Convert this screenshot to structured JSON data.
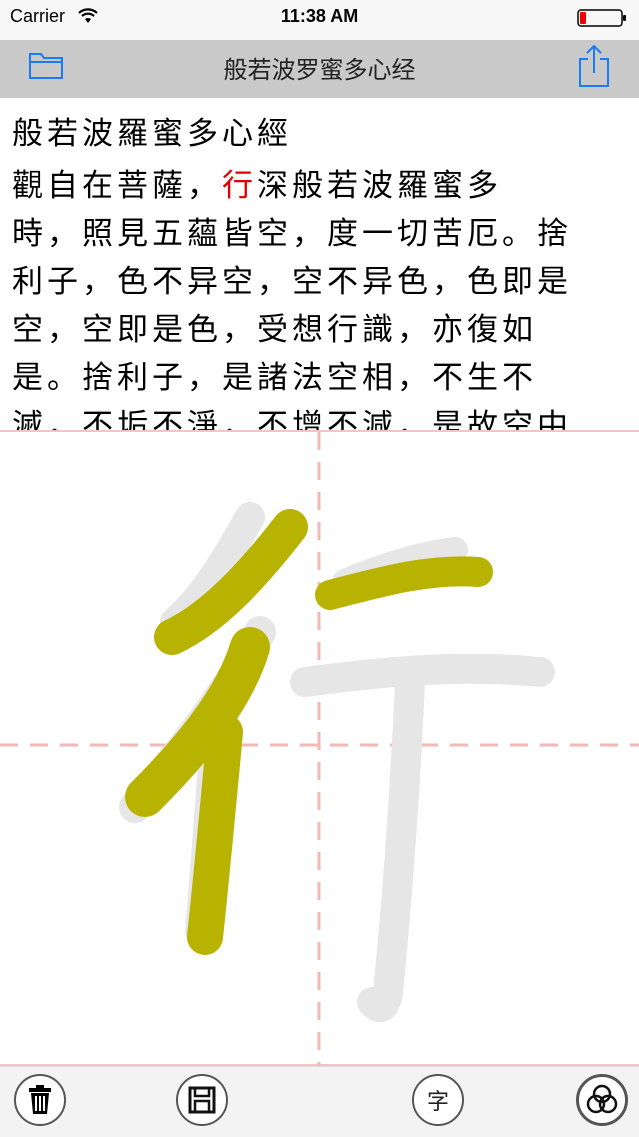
{
  "status_bar": {
    "carrier": "Carrier",
    "time": "11:38 AM"
  },
  "nav": {
    "title": "般若波罗蜜多心经"
  },
  "sutra": {
    "title": "般若波羅蜜多心經",
    "highlight_char": "行",
    "lines": [
      {
        "pre": "觀自在菩薩，",
        "hl": "行",
        "post": "深般若波羅蜜多"
      },
      {
        "pre": "時，照見五蘊皆空，度一切苦厄。捨",
        "hl": "",
        "post": ""
      },
      {
        "pre": "利子，色不异空，空不异色，色即是",
        "hl": "",
        "post": ""
      },
      {
        "pre": "空，空即是色，受想行識，亦復如",
        "hl": "",
        "post": ""
      },
      {
        "pre": "是。捨利子，是諸法空相，不生不",
        "hl": "",
        "post": ""
      },
      {
        "pre": "滅，不垢不淨，不增不減，是故空中",
        "hl": "",
        "post": ""
      }
    ]
  },
  "canvas": {
    "guide_char": "行",
    "ink_color": "#b8b300",
    "guide_color": "#e4e4e4",
    "grid_color": "#f3b9b9"
  },
  "toolbar": {
    "single_char_label": "字"
  },
  "colors": {
    "accent": "#1a7cf5",
    "highlight": "#e00000"
  }
}
